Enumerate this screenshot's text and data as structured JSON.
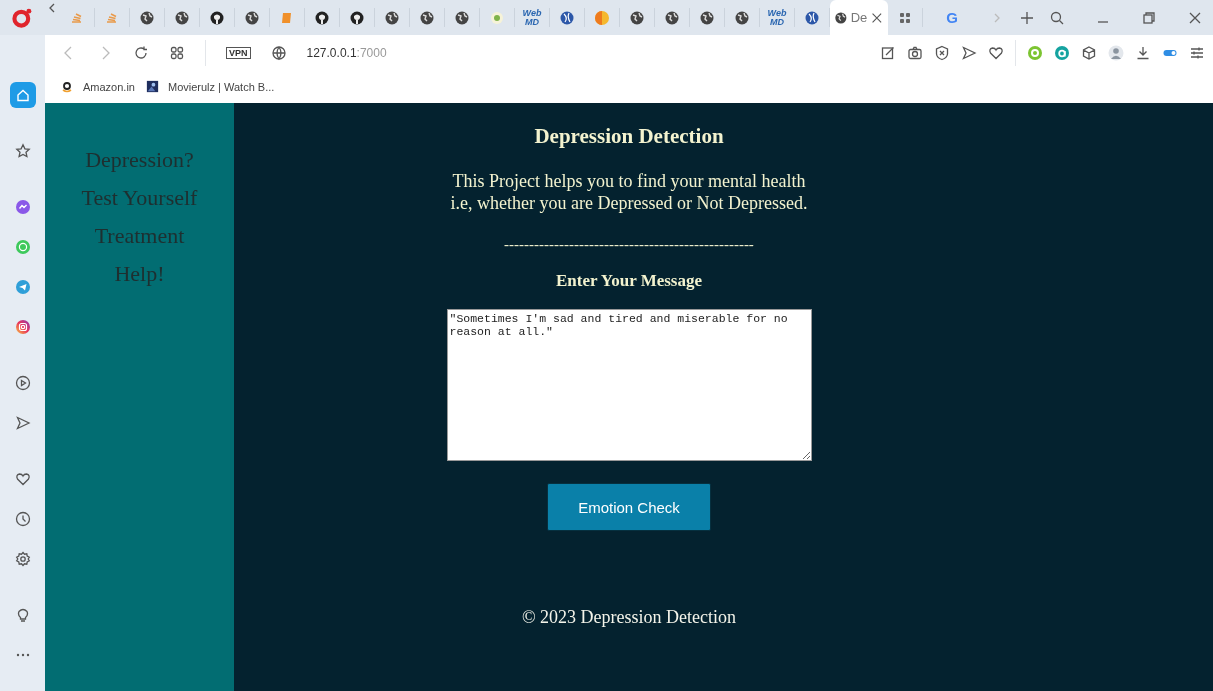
{
  "tabs": [
    {
      "kind": "stack",
      "selected": false
    },
    {
      "kind": "stack",
      "selected": false
    },
    {
      "kind": "globe",
      "selected": false
    },
    {
      "kind": "globe",
      "selected": false
    },
    {
      "kind": "github",
      "selected": false
    },
    {
      "kind": "globe",
      "selected": false
    },
    {
      "kind": "book",
      "selected": false
    },
    {
      "kind": "github",
      "selected": false
    },
    {
      "kind": "github",
      "selected": false
    },
    {
      "kind": "globe",
      "selected": false
    },
    {
      "kind": "globe",
      "selected": false
    },
    {
      "kind": "globe",
      "selected": false
    },
    {
      "kind": "edge",
      "selected": false
    },
    {
      "kind": "webmd",
      "label": "Web MD",
      "selected": false
    },
    {
      "kind": "ball",
      "selected": false
    },
    {
      "kind": "half",
      "selected": false
    },
    {
      "kind": "globe",
      "selected": false
    },
    {
      "kind": "globe",
      "selected": false
    },
    {
      "kind": "globe",
      "selected": false
    },
    {
      "kind": "globe",
      "selected": false
    },
    {
      "kind": "webmd",
      "label": "Web MD",
      "selected": false
    },
    {
      "kind": "ball",
      "selected": false
    },
    {
      "kind": "globe",
      "label": "De",
      "selected": true
    },
    {
      "kind": "grid",
      "selected": false
    },
    {
      "kind": "google",
      "label": "G",
      "selected": false
    }
  ],
  "address_bar": {
    "vpn": "VPN",
    "host": "127.0.0.1",
    "port": ":7000"
  },
  "bookmarks": [
    {
      "kind": "amazon",
      "label": "Amazon.in"
    },
    {
      "kind": "movie",
      "label": "Movierulz | Watch B..."
    }
  ],
  "sidebar": {
    "items": [
      {
        "kind": "home",
        "selected": true
      },
      {
        "kind": "star",
        "selected": false
      },
      {
        "kind": "messenger",
        "selected": false
      },
      {
        "kind": "whatsapp",
        "selected": false
      },
      {
        "kind": "telegram",
        "selected": false
      },
      {
        "kind": "instagram",
        "selected": false
      },
      {
        "kind": "play",
        "selected": false
      },
      {
        "kind": "send",
        "selected": false
      },
      {
        "kind": "heart",
        "selected": false
      },
      {
        "kind": "clock",
        "selected": false
      },
      {
        "kind": "gear",
        "selected": false
      },
      {
        "kind": "bulb",
        "selected": false
      },
      {
        "kind": "more",
        "selected": false
      }
    ]
  },
  "page": {
    "nav": [
      "Depression?",
      "Test Yourself",
      "Treatment",
      "Help!"
    ],
    "title": "Depression Detection",
    "intro": [
      "This Project helps you to find your mental health",
      "i.e, whether you are Depressed or Not Depressed."
    ],
    "divider": "--------------------------------------------------",
    "prompt": "Enter Your Message",
    "message": "\"Sometimes I'm sad and tired and miserable for no reason at all.\"",
    "button": "Emotion Check",
    "footer": "© 2023 Depression Detection"
  }
}
